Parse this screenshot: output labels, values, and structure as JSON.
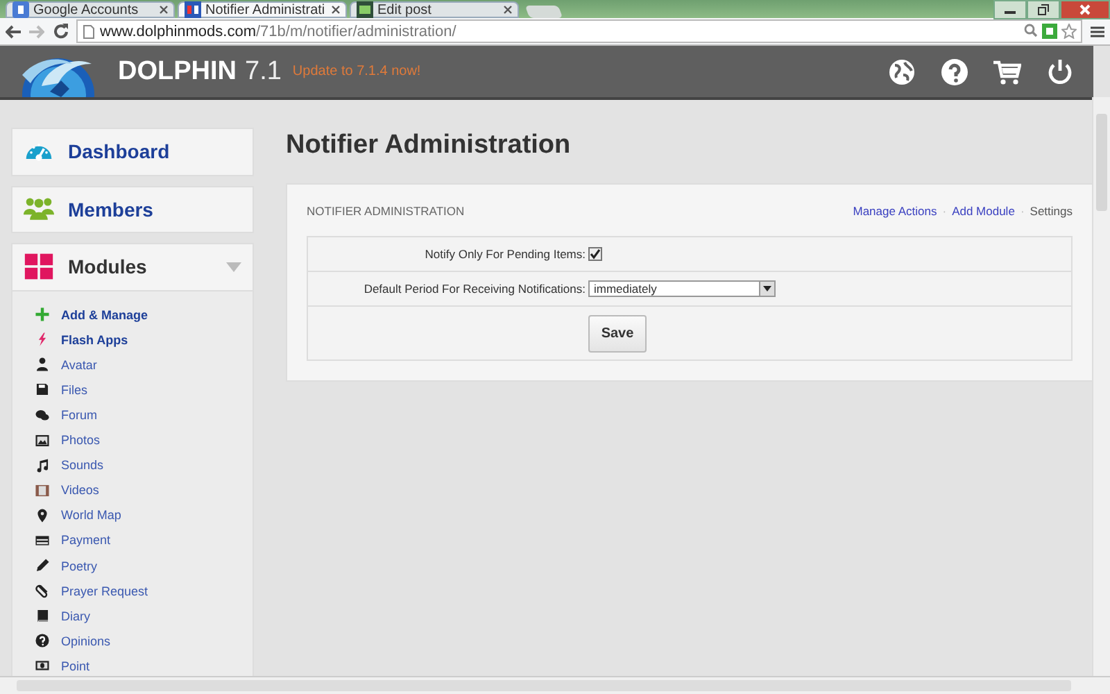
{
  "browser": {
    "tabs": [
      {
        "label": "Google Accounts",
        "selected": false,
        "kind": "google"
      },
      {
        "label": "Notifier Administrati",
        "selected": true,
        "kind": "site"
      },
      {
        "label": "Edit post",
        "selected": false,
        "kind": "editor"
      }
    ],
    "address": {
      "domain": "www.dolphinmods.com",
      "path": "/71b/m/notifier/administration/"
    }
  },
  "header": {
    "brand": "DOLPHIN",
    "version": "7.1",
    "update": "Update to 7.1.4 now!"
  },
  "sidebar": {
    "sections": [
      {
        "label": "Dashboard",
        "kind": "dashboard"
      },
      {
        "label": "Members",
        "kind": "members"
      },
      {
        "label": "Modules",
        "kind": "modules",
        "expanded": true
      }
    ],
    "items": [
      {
        "label": "Add & Manage",
        "kind": "plus",
        "bold": true
      },
      {
        "label": "Flash Apps",
        "kind": "bolt",
        "bold": true
      },
      {
        "label": "Avatar",
        "kind": "person",
        "bold": false
      },
      {
        "label": "Files",
        "kind": "floppy",
        "bold": false
      },
      {
        "label": "Forum",
        "kind": "chat",
        "bold": false
      },
      {
        "label": "Photos",
        "kind": "photo",
        "bold": false
      },
      {
        "label": "Sounds",
        "kind": "note",
        "bold": false
      },
      {
        "label": "Videos",
        "kind": "film",
        "bold": false
      },
      {
        "label": "World Map",
        "kind": "pin",
        "bold": false
      },
      {
        "label": "Payment",
        "kind": "card",
        "bold": false
      },
      {
        "label": "Poetry",
        "kind": "pencil",
        "bold": false
      },
      {
        "label": "Prayer Request",
        "kind": "clip",
        "bold": false
      },
      {
        "label": "Diary",
        "kind": "book",
        "bold": false
      },
      {
        "label": "Opinions",
        "kind": "question",
        "bold": false
      },
      {
        "label": "Point",
        "kind": "money",
        "bold": false
      }
    ]
  },
  "page": {
    "title": "Notifier Administration",
    "panel": {
      "title": "NOTIFIER ADMINISTRATION",
      "links": [
        {
          "label": "Manage Actions",
          "selected": false
        },
        {
          "separator": "·",
          "label": "Add Module",
          "selected": false
        },
        {
          "separator": "·",
          "label": "Settings",
          "selected": true
        }
      ],
      "fields": [
        {
          "label": "Notify Only For Pending Items:",
          "kind": "checkbox",
          "checked": true
        },
        {
          "label": "Default Period For Receiving Notifications:",
          "kind": "select",
          "value": "immediately"
        }
      ],
      "submit": "Save"
    }
  }
}
